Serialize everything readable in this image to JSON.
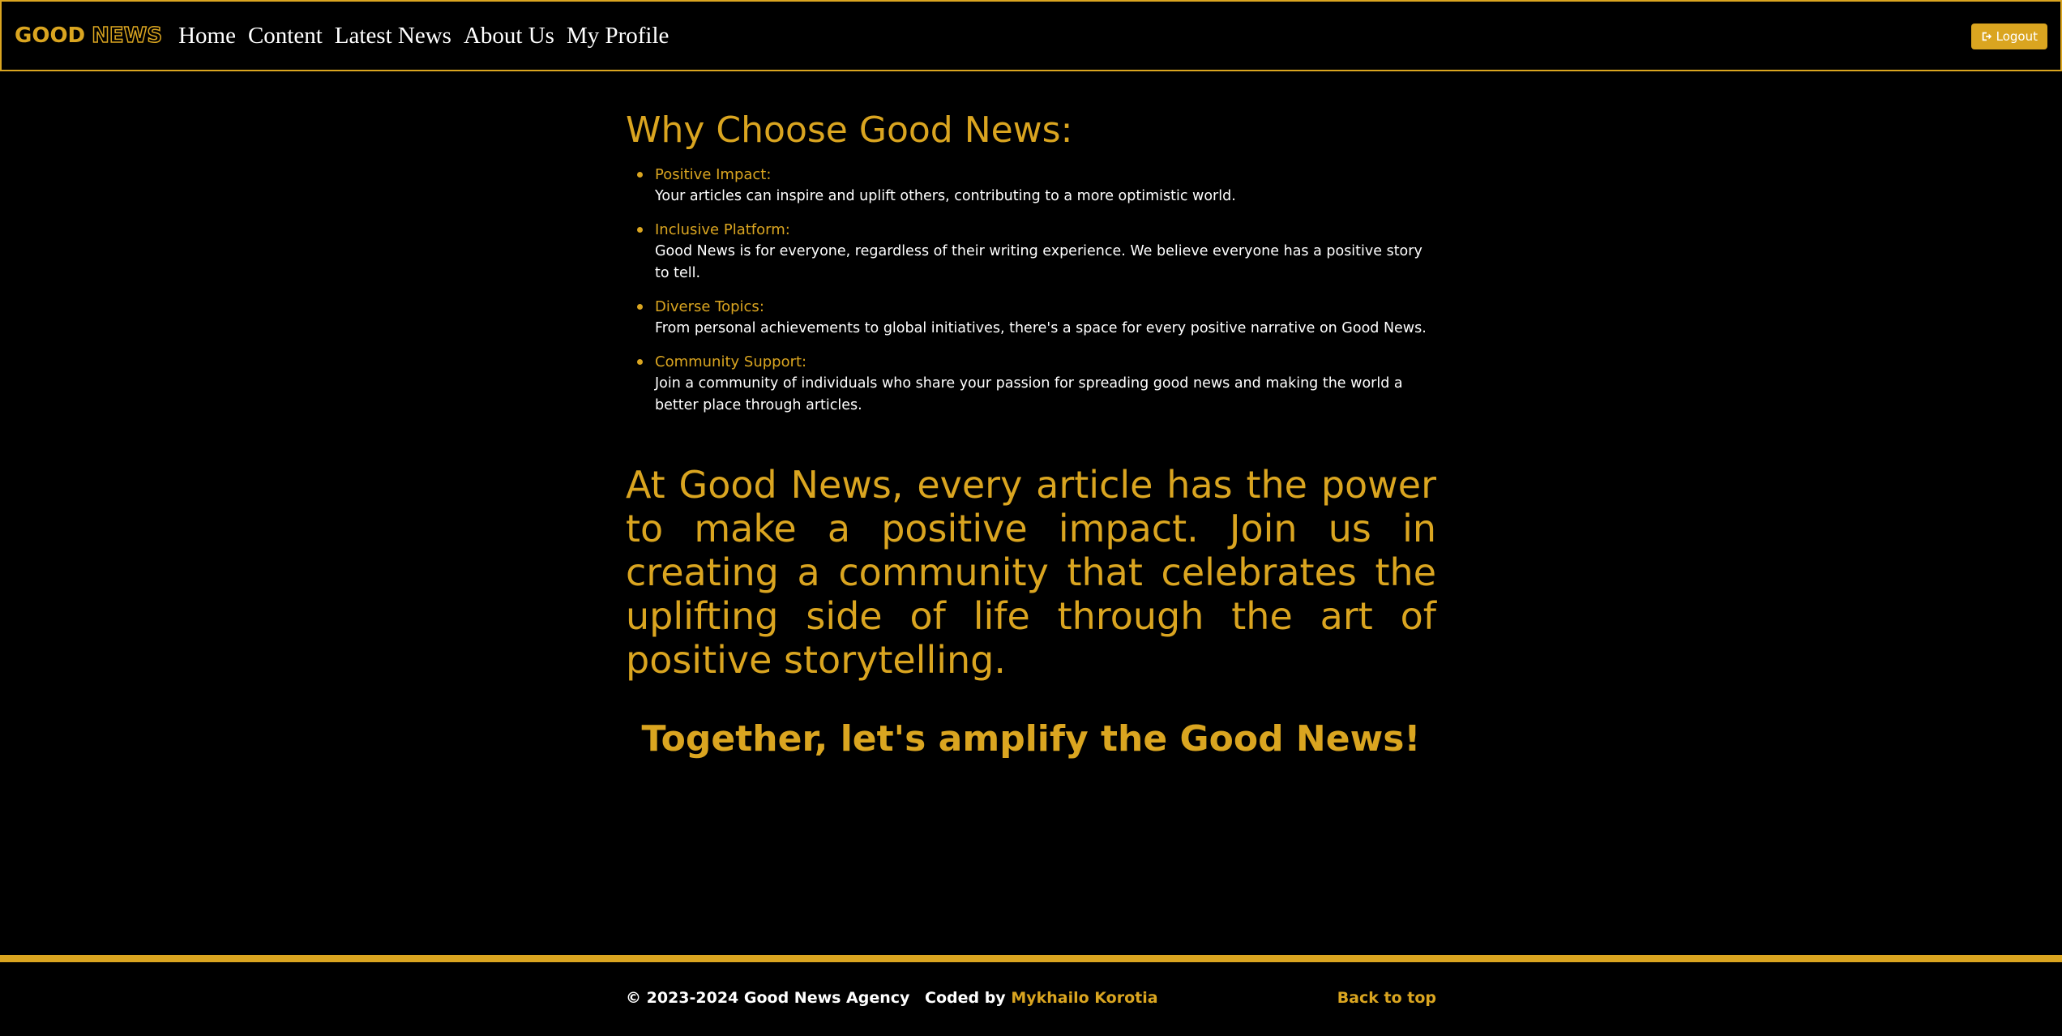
{
  "brand": {
    "part1": "GOOD",
    "part2": "NEWS"
  },
  "nav": {
    "items": [
      {
        "label": "Home"
      },
      {
        "label": "Content"
      },
      {
        "label": "Latest News"
      },
      {
        "label": "About Us"
      },
      {
        "label": "My Profile"
      }
    ],
    "logout_label": "Logout",
    "logout_icon": "sign-out-icon"
  },
  "main": {
    "title": "Why Choose Good News:",
    "benefits": [
      {
        "title": "Positive Impact:",
        "desc": "Your articles can inspire and uplift others, contributing to a more optimistic world."
      },
      {
        "title": "Inclusive Platform:",
        "desc": "Good News is for everyone, regardless of their writing experience. We believe everyone has a positive story to tell."
      },
      {
        "title": "Diverse Topics:",
        "desc": "From personal achievements to global initiatives, there's a space for every positive narrative on Good News."
      },
      {
        "title": "Community Support:",
        "desc": "Join a community of individuals who share your passion for spreading good news and making the world a better place through articles."
      }
    ],
    "impact": "At Good News, every article has the power to make a positive impact. Join us in creating a community that celebrates the uplifting side of life through the art of positive storytelling.",
    "together": "Together, let's amplify the Good News!"
  },
  "footer": {
    "copyright": "© 2023-2024 Good News Agency",
    "coded_by": "Coded by",
    "coder": "Mykhailo Korotia",
    "back_to_top": "Back to top"
  },
  "colors": {
    "accent": "#daa520",
    "background": "#000000",
    "text": "#ffffff"
  }
}
